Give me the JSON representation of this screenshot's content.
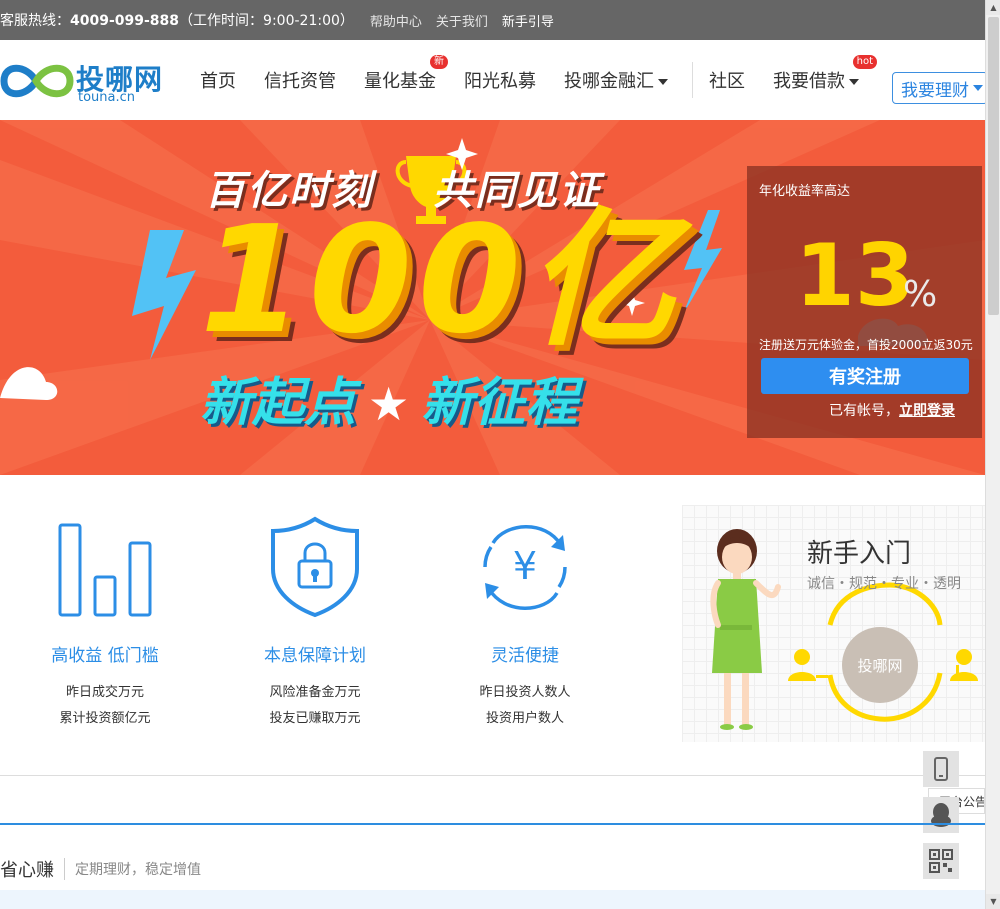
{
  "topbar": {
    "hotline_label": "客服热线：",
    "hotline_number": "4009-099-888",
    "hours": "（工作时间：9:00-21:00）",
    "links": [
      "帮助中心",
      "关于我们",
      "新手引导"
    ]
  },
  "logo": {
    "brand": "投哪网",
    "domain": "touna.cn"
  },
  "nav": {
    "items": [
      {
        "label": "首页"
      },
      {
        "label": "信托资管"
      },
      {
        "label": "量化基金",
        "badge": "新"
      },
      {
        "label": "阳光私募"
      },
      {
        "label": "投哪金融汇"
      },
      {
        "label": "社区"
      },
      {
        "label": "我要借款",
        "badge": "hot"
      }
    ],
    "cta": "我要理财"
  },
  "banner": {
    "headline_left": "百亿时刻",
    "headline_right": "共同见证",
    "big_number": "100亿",
    "slogan_left": "新起点",
    "slogan_right": "新征程"
  },
  "promo": {
    "label": "年化收益率高达",
    "rate": "13",
    "percent": "%",
    "note": "注册送万元体验金，首投2000立返30元",
    "register": "有奖注册",
    "login_prefix": "已有帐号，",
    "login_link": "立即登录"
  },
  "features": [
    {
      "title": "高收益 低门槛",
      "stats": [
        "昨日成交万元",
        "累计投资额亿元"
      ]
    },
    {
      "title": "本息保障计划",
      "stats": [
        "风险准备金万元",
        "投友已赚取万元"
      ]
    },
    {
      "title": "灵活便捷",
      "stats": [
        "昨日投资人数人",
        "投资用户数人"
      ]
    }
  ],
  "guide": {
    "title": "新手入门",
    "subtitle": "诚信・规范・专业・透明",
    "center": "投哪网"
  },
  "notice": "平台公告",
  "section": {
    "title": "省心赚",
    "subtitle": "定期理财，稳定增值"
  },
  "colors": {
    "brand_blue": "#2c8ee6",
    "banner_red": "#f35c3c",
    "accent_yellow": "#ffd800"
  }
}
